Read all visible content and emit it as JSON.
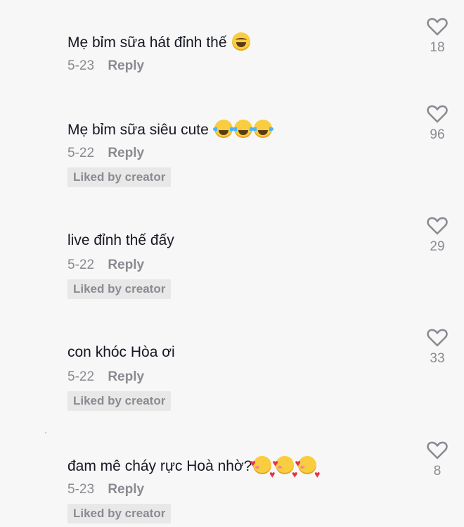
{
  "comments": [
    {
      "text": "Mẹ bỉm sữa hát đỉnh thế",
      "emojis": [
        "laughing-face"
      ],
      "date": "5-23",
      "reply": "Reply",
      "badge": "",
      "likes": "18"
    },
    {
      "text": "Mẹ bỉm sữa siêu cute",
      "emojis": [
        "tears-of-joy",
        "tears-of-joy",
        "tears-of-joy"
      ],
      "date": "5-22",
      "reply": "Reply",
      "badge": "Liked by creator",
      "likes": "96"
    },
    {
      "text": "live đỉnh thế đấy",
      "emojis": [],
      "date": "5-22",
      "reply": "Reply",
      "badge": "Liked by creator",
      "likes": "29"
    },
    {
      "text": "con khóc Hòa ơi",
      "emojis": [],
      "date": "5-22",
      "reply": "Reply",
      "badge": "Liked by creator",
      "likes": "33"
    },
    {
      "text": "đam mê cháy rực Hoà nhờ?",
      "emojis": [
        "smiling-with-hearts",
        "smiling-with-hearts",
        "smiling-with-hearts"
      ],
      "date": "5-23",
      "reply": "Reply",
      "badge": "Liked by creator",
      "likes": "8"
    }
  ],
  "colors": {
    "background": "#f7f7f7",
    "text": "#161823",
    "muted": "#8a8b91",
    "badge_bg": "#e8e8e8"
  }
}
